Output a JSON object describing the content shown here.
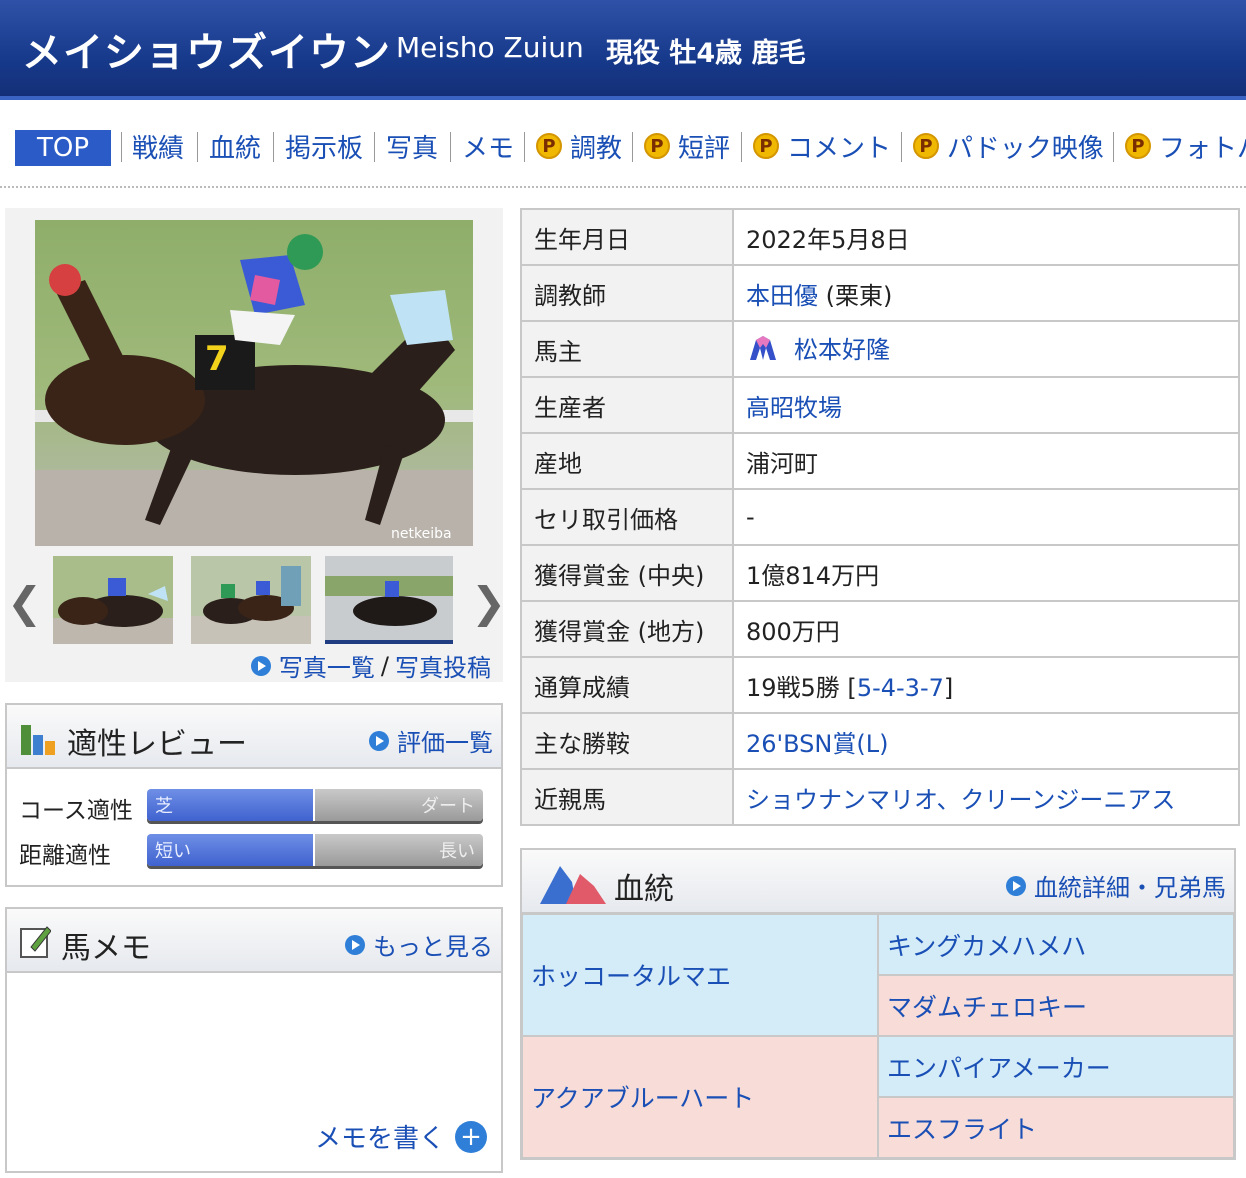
{
  "header": {
    "name_jp": "メイショウズイウン",
    "name_en": "Meisho Zuiun",
    "info": "現役 牡4歳 鹿毛"
  },
  "nav": {
    "top": "TOP",
    "items": [
      "戦績",
      "血統",
      "掲示板",
      "写真",
      "メモ"
    ],
    "premium_items": [
      "調教",
      "短評",
      "コメント",
      "パドック映像",
      "フォトパ"
    ],
    "premium_badge": "P"
  },
  "photos": {
    "watermark": "netkeiba",
    "list_link": "写真一覧",
    "separator": "/",
    "post_link": "写真投稿",
    "prev_arrow": "❮",
    "next_arrow": "❯"
  },
  "aptitude": {
    "title": "適性レビュー",
    "link": "評価一覧",
    "rows": [
      {
        "label": "コース適性",
        "left": "芝",
        "right": "ダート",
        "level": 0.5
      },
      {
        "label": "距離適性",
        "left": "短い",
        "right": "長い",
        "level": 0.5
      }
    ]
  },
  "memo": {
    "title": "馬メモ",
    "link": "もっと見る",
    "write": "メモを書く"
  },
  "profile": {
    "rows": [
      {
        "key": "生年月日",
        "value": "2022年5月8日"
      },
      {
        "key": "調教師",
        "value_link": "本田優",
        "value_suffix": " (栗東)"
      },
      {
        "key": "馬主",
        "value_link": "松本好隆"
      },
      {
        "key": "生産者",
        "value_link": "高昭牧場"
      },
      {
        "key": "産地",
        "value": "浦河町"
      },
      {
        "key": "セリ取引価格",
        "value": "-"
      },
      {
        "key": "獲得賞金 (中央)",
        "value": "1億814万円"
      },
      {
        "key": "獲得賞金 (地方)",
        "value": "800万円"
      },
      {
        "key": "通算成績",
        "value": "19戦5勝 [",
        "value_link": "5-4-3-7",
        "value_suffix": "]"
      },
      {
        "key": "主な勝鞍",
        "value_link": "26'BSN賞(L)"
      },
      {
        "key": "近親馬",
        "value_link": "ショウナンマリオ、クリーンジーニアス"
      }
    ]
  },
  "pedigree": {
    "title": "血統",
    "link": "血統詳細・兄弟馬",
    "sire": "ホッコータルマエ",
    "dam": "アクアブルーハート",
    "sire_sire": "キングカメハメハ",
    "sire_dam": "マダムチェロキー",
    "dam_sire": "エンパイアメーカー",
    "dam_dam": "エスフライト"
  },
  "colors": {
    "header": "#173a8c",
    "link": "#1a4fb5",
    "sire_bg": "#d3ecf8",
    "dam_bg": "#f7dcd8"
  }
}
